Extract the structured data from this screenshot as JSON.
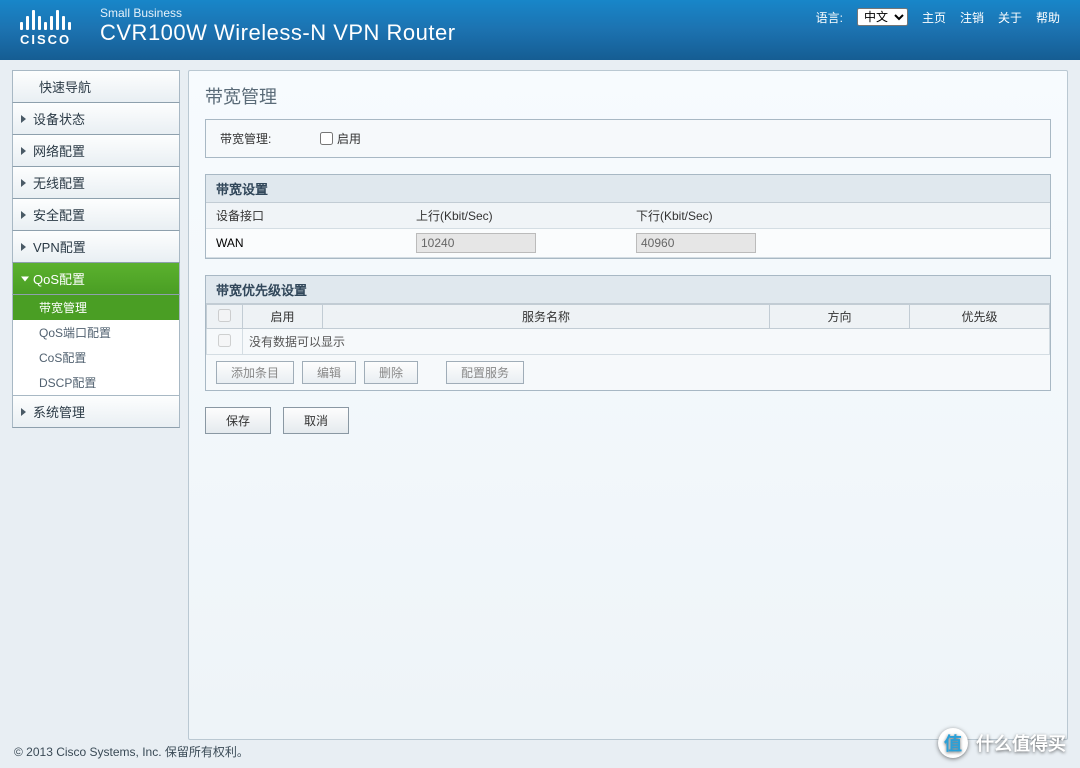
{
  "header": {
    "brand_small": "Small Business",
    "brand_title": "CVR100W Wireless-N VPN Router",
    "lang_label": "语言:",
    "lang_value": "中文",
    "links": {
      "home": "主页",
      "logout": "注销",
      "about": "关于",
      "help": "帮助"
    }
  },
  "sidebar": {
    "items": [
      {
        "label": "快速导航"
      },
      {
        "label": "设备状态"
      },
      {
        "label": "网络配置"
      },
      {
        "label": "无线配置"
      },
      {
        "label": "安全配置"
      },
      {
        "label": "VPN配置"
      },
      {
        "label": "QoS配置"
      },
      {
        "label": "系统管理"
      }
    ],
    "sub_qos": [
      {
        "label": "带宽管理",
        "selected": true
      },
      {
        "label": "QoS端口配置"
      },
      {
        "label": "CoS配置"
      },
      {
        "label": "DSCP配置"
      }
    ]
  },
  "page": {
    "title": "带宽管理",
    "enable_label": "带宽管理:",
    "enable_checkbox": "启用",
    "bw_section": "带宽设置",
    "bw_cols": {
      "iface": "设备接口",
      "up": "上行(Kbit/Sec)",
      "down": "下行(Kbit/Sec)"
    },
    "bw_row": {
      "iface": "WAN",
      "up": "10240",
      "down": "40960"
    },
    "prio_section": "带宽优先级设置",
    "prio_cols": {
      "enable": "启用",
      "service": "服务名称",
      "direction": "方向",
      "priority": "优先级"
    },
    "prio_empty": "没有数据可以显示",
    "buttons": {
      "add": "添加条目",
      "edit": "编辑",
      "delete": "删除",
      "config": "配置服务",
      "save": "保存",
      "cancel": "取消"
    }
  },
  "footer": {
    "copyright": "© 2013 Cisco Systems, Inc. 保留所有权利。"
  },
  "watermark": {
    "badge": "值",
    "text": "什么值得买"
  }
}
